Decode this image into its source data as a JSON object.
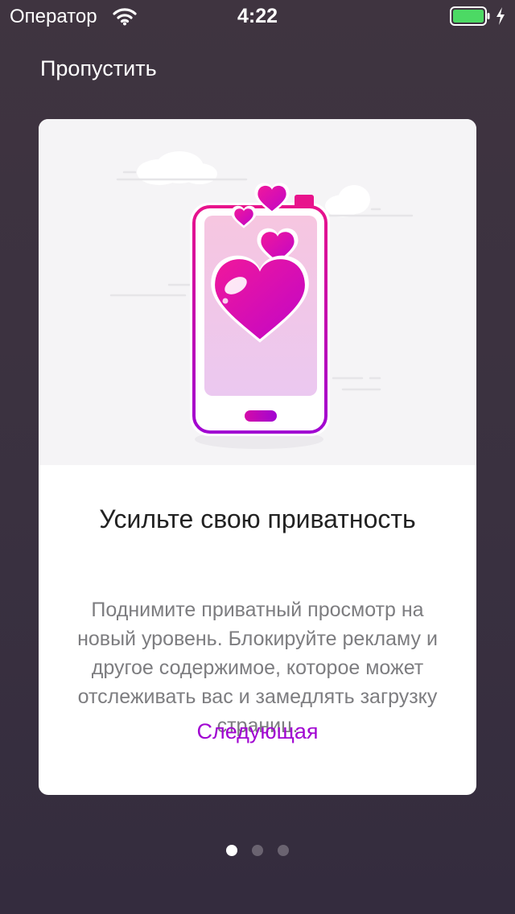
{
  "status_bar": {
    "carrier": "Оператор",
    "time": "4:22",
    "battery_level": 1.0,
    "battery_color": "#4cd964",
    "wifi_icon": "wifi-icon",
    "charging_icon": "bolt-icon"
  },
  "onboarding": {
    "skip_label": "Пропустить",
    "title": "Усильте свою приватность",
    "body": "Поднимите приватный просмотр на новый уровень. Блокируйте рекламу и другое содержимое, которое может отслеживать вас и замедлять загрузку страниц.",
    "next_label": "Следующая",
    "illustration_icon": "phone-with-hearts-illustration",
    "accent_color": "#a106d2"
  },
  "pagination": {
    "total_pages": 3,
    "current_page": 1
  }
}
